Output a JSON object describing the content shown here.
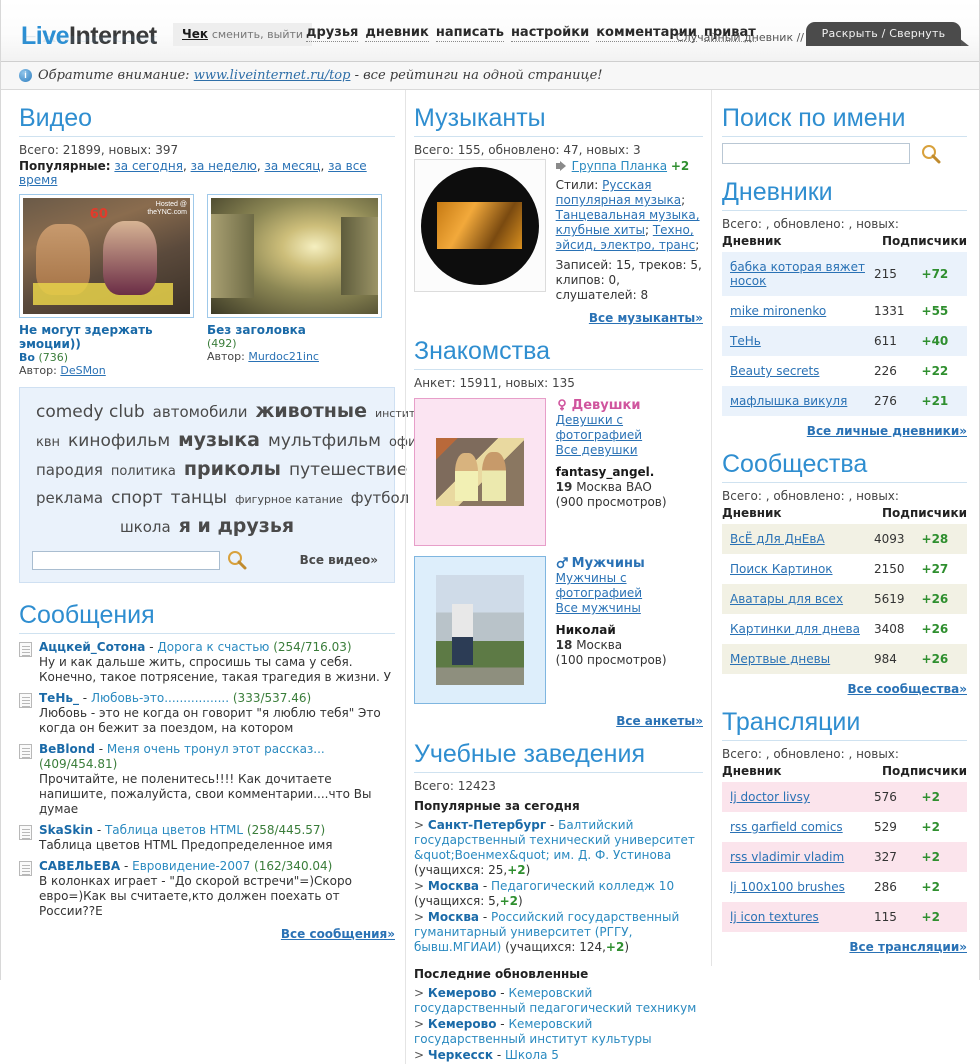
{
  "header": {
    "logo_live": "Live",
    "logo_internet": "Internet",
    "account_nick": "Чек",
    "account_actions": "сменить, выйти",
    "nav": [
      {
        "label": "друзья"
      },
      {
        "label": "дневник"
      },
      {
        "label": "написать"
      },
      {
        "label": "настройки"
      },
      {
        "label": "комментарии"
      },
      {
        "label": "приват"
      }
    ],
    "random_diary": "Случайный дневник //",
    "toggle_label": "Раскрыть / Свернуть"
  },
  "notice": {
    "icon": "info-icon",
    "prefix": "Обратите внимание:",
    "link": "www.liveinternet.ru/top",
    "suffix": "- все рейтинги на одной странице!"
  },
  "video": {
    "title": "Видео",
    "stats": "Всего: 21899, новых: 397",
    "popular_label": "Популярные:",
    "popular_links": [
      "за сегодня",
      "за неделю",
      "за месяц",
      "за все время"
    ],
    "items": [
      {
        "title": "Не могут здержать эмоции))",
        "bo": "Во",
        "count": "(736)",
        "author_label": "Автор:",
        "author": "DeSMon"
      },
      {
        "title": "Без заголовка",
        "bo": "",
        "count": "(492)",
        "author_label": "Автор:",
        "author": "Murdoc21inc"
      }
    ],
    "tags": [
      {
        "label": "comedy club",
        "size": "s4"
      },
      {
        "label": "автомобили",
        "size": "s3"
      },
      {
        "label": "животные",
        "size": "s5"
      },
      {
        "label": "институт",
        "size": "s2"
      },
      {
        "label": "квн",
        "size": "s2"
      },
      {
        "label": "кинофильм",
        "size": "s4"
      },
      {
        "label": "музыка",
        "size": "s5"
      },
      {
        "label": "мультфильм",
        "size": "s4"
      },
      {
        "label": "офис",
        "size": "s2"
      },
      {
        "label": "пародия",
        "size": "s3"
      },
      {
        "label": "политика",
        "size": "s2"
      },
      {
        "label": "приколы",
        "size": "s5"
      },
      {
        "label": "путешествие",
        "size": "s4"
      },
      {
        "label": "реклама",
        "size": "s4"
      },
      {
        "label": "спорт",
        "size": "s4"
      },
      {
        "label": "танцы",
        "size": "s4"
      },
      {
        "label": "фигурное катание",
        "size": "s2"
      },
      {
        "label": "футбол",
        "size": "s4"
      },
      {
        "label": "школа",
        "size": "s3"
      },
      {
        "label": "я и друзья",
        "size": "s5"
      }
    ],
    "search_value": "",
    "search_placeholder": "",
    "all_link": "Все видео»"
  },
  "messages": {
    "title": "Сообщения",
    "items": [
      {
        "user": "Аццкей_Сотона",
        "title": "Дорога к счастью",
        "num": "(254/716.03)",
        "text": "Ну и как дальше жить, спросишь ты сама у себя. Конечно, такое потрясение, такая трагедия в жизни. У"
      },
      {
        "user": "ТеНь_",
        "title": "Любовь-это.................",
        "num": "(333/537.46)",
        "text": "Любовь - это не когда он говорит \"я люблю тебя\" Это когда он бежит за поездом, на котором"
      },
      {
        "user": "BeBlond",
        "title": "Меня очень тронул этот рассказ...",
        "num": "(409/454.81)",
        "text": "Прочитайте, не поленитесь!!!! Как дочитаете напишите, пожалуйста, свои комментарии....что Вы думае"
      },
      {
        "user": "SkaSkin",
        "title": "Таблица цветов HTML",
        "num": "(258/445.57)",
        "text": "Таблица цветов HTML Предопределенное имя"
      },
      {
        "user": "САВЕЛЬЕВА",
        "title": "Евровидение-2007",
        "num": "(162/340.04)",
        "text": "В колонках играет - \"До скорой встречи\"=)Скоро евро=)Как вы считаете,кто должен поехать от России??Е"
      }
    ],
    "all_link": "Все сообщения»"
  },
  "musicians": {
    "title": "Музыканты",
    "stats": "Всего: 155, обновлено: 47, новых: 3",
    "icon": "speaker-icon",
    "name": "Группа Планка",
    "plus": "+2",
    "styles_label": "Стили:",
    "styles": [
      "Русская популярная музыка",
      "Танцевальная музыка, клубные хиты",
      "Техно, эйсид, электро, транс"
    ],
    "counts": "Записей: 15, треков: 5, клипов: 0, слушателей: 8",
    "all_link": "Все музыканты»"
  },
  "dating": {
    "title": "Знакомства",
    "stats": "Анкет: 15911, новых: 135",
    "groups": [
      {
        "icon": "female-symbol-icon",
        "head": "Девушки",
        "links": [
          "Девушки с фотографией",
          "Все девушки"
        ],
        "person": "fantasy_angel.",
        "age": "19",
        "city": "Москва ВАО",
        "views": "(900 просмотров)"
      },
      {
        "icon": "male-symbol-icon",
        "head": "Мужчины",
        "links": [
          "Мужчины с фотографией",
          "Все мужчины"
        ],
        "person": "Николай",
        "age": "18",
        "city": "Москва",
        "views": "(100 просмотров)"
      }
    ],
    "all_link": "Все анкеты»"
  },
  "education": {
    "title": "Учебные заведения",
    "stats": "Всего: 12423",
    "popular_label": "Популярные за сегодня",
    "popular": [
      {
        "city": "Санкт-Петербург",
        "name": "Балтийский государственный технический университет &quot;Военмех&quot; им. Д. Ф. Устинова",
        "count": "(учащихся: 25,",
        "plus": "+2",
        "tail": ")"
      },
      {
        "city": "Москва",
        "name": "Педагогический колледж 10",
        "count": "(учащихся: 5,",
        "plus": "+2",
        "tail": ")"
      },
      {
        "city": "Москва",
        "name": "Российский государственный гуманитарный университет (РГГУ, бывш.МГИАИ)",
        "count": "(учащихся: 124,",
        "plus": "+2",
        "tail": ")"
      }
    ],
    "latest_label": "Последние обновленные",
    "latest": [
      {
        "city": "Кемерово",
        "name": "Кемеровский государственный педагогический техникум"
      },
      {
        "city": "Кемерово",
        "name": "Кемеровский государственный институт культуры"
      },
      {
        "city": "Черкесск",
        "name": "Школа 5"
      }
    ]
  },
  "name_search": {
    "title": "Поиск по имени",
    "value": "",
    "placeholder": "",
    "icon": "search-icon"
  },
  "diaries": {
    "title": "Дневники",
    "stats": "Всего: , обновлено: , новых:",
    "col_name": "Дневник",
    "col_subs": "Подписчики",
    "rows": [
      {
        "name": "бабка которая вяжет носок",
        "count": "215",
        "plus": "+72"
      },
      {
        "name": "mike mironenko",
        "count": "1331",
        "plus": "+55"
      },
      {
        "name": "ТеНь",
        "count": "611",
        "plus": "+40"
      },
      {
        "name": "Beauty secrets",
        "count": "226",
        "plus": "+22"
      },
      {
        "name": "мафлышка викуля",
        "count": "276",
        "plus": "+21"
      }
    ],
    "all_link": "Все личные дневники»"
  },
  "communities": {
    "title": "Сообщества",
    "stats": "Всего: , обновлено: , новых:",
    "col_name": "Дневник",
    "col_subs": "Подписчики",
    "rows": [
      {
        "name": "ВсЁ дЛя ДнЕвА",
        "count": "4093",
        "plus": "+28"
      },
      {
        "name": "Поиск Картинок",
        "count": "2150",
        "plus": "+27"
      },
      {
        "name": "Аватары для всех",
        "count": "5619",
        "plus": "+26"
      },
      {
        "name": "Картинки для днева",
        "count": "3408",
        "plus": "+26"
      },
      {
        "name": "Мертвые дневы",
        "count": "984",
        "plus": "+26"
      }
    ],
    "all_link": "Все сообщества»"
  },
  "broadcasts": {
    "title": "Трансляции",
    "stats": "Всего: , обновлено: , новых:",
    "col_name": "Дневник",
    "col_subs": "Подписчики",
    "rows": [
      {
        "name": "lj doctor livsy",
        "count": "576",
        "plus": "+2"
      },
      {
        "name": "rss garfield comics",
        "count": "529",
        "plus": "+2"
      },
      {
        "name": "rss vladimir vladim",
        "count": "327",
        "plus": "+2"
      },
      {
        "name": "lj 100x100 brushes",
        "count": "286",
        "plus": "+2"
      },
      {
        "name": "lj icon textures",
        "count": "115",
        "plus": "+2"
      }
    ],
    "all_link": "Все трансляции»"
  },
  "colors": {
    "accent": "#2f8ed0",
    "link": "#2a72b5",
    "green": "#2f8f2f",
    "diary_row": "#eaf2fb",
    "community_row": "#f2f1e4",
    "broadcast_row": "#fbe4ec"
  }
}
